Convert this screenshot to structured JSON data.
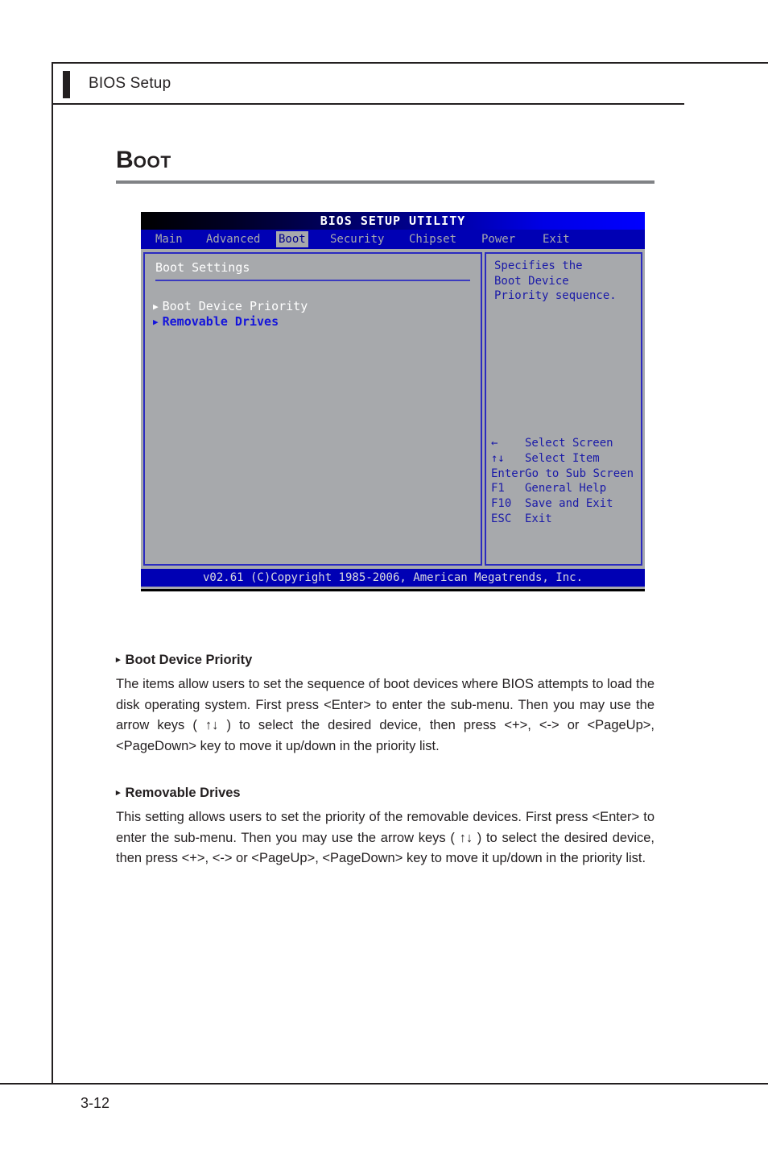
{
  "page": {
    "header_title": "BIOS Setup",
    "section_title_first": "B",
    "section_title_rest": "OOT",
    "page_number": "3-12"
  },
  "bios": {
    "window_title": "BIOS SETUP UTILITY",
    "menu": [
      {
        "label": "Main",
        "active": false
      },
      {
        "label": "Advanced",
        "active": false
      },
      {
        "label": "Boot",
        "active": true
      },
      {
        "label": "Security",
        "active": false
      },
      {
        "label": "Chipset",
        "active": false
      },
      {
        "label": "Power",
        "active": false
      },
      {
        "label": "Exit",
        "active": false
      }
    ],
    "left_panel": {
      "heading": "Boot Settings",
      "items": [
        {
          "label": "Boot Device Priority",
          "selected": false
        },
        {
          "label": "Removable Drives",
          "selected": true
        }
      ]
    },
    "right_panel": {
      "help_text": "Specifies the\nBoot Device\nPriority sequence.",
      "key_legend": [
        {
          "key": "←",
          "desc": "Select Screen"
        },
        {
          "key": "↑↓",
          "desc": "Select Item"
        },
        {
          "key": "Enter",
          "desc": "Go to Sub Screen"
        },
        {
          "key": "F1",
          "desc": "General Help"
        },
        {
          "key": "F10",
          "desc": "Save and Exit"
        },
        {
          "key": "ESC",
          "desc": "Exit"
        }
      ]
    },
    "status_bar": "v02.61 (C)Copyright 1985-2006, American Megatrends, Inc.",
    "colors": {
      "panel_bg": "#a7a9ac",
      "menu_bg": "#0000b4",
      "border": "#2b2bc0",
      "selected_text": "#1414dc",
      "help_text": "#1a1aa8"
    }
  },
  "sections": [
    {
      "heading": "Boot Device Priority",
      "body": "The items allow users to set the sequence of boot devices where BIOS attempts to load the disk operating system. First press <Enter> to enter the sub-menu. Then you may use the arrow keys ( ↑↓ ) to select the desired device, then press <+>, <-> or <PageUp>, <PageDown> key to move it up/down in the priority list."
    },
    {
      "heading": "Removable Drives",
      "body": "This setting allows users to set the priority of the removable devices. First press <Enter> to enter the sub-menu. Then you may use the arrow keys ( ↑↓ ) to select the desired device, then press <+>, <-> or <PageUp>, <PageDown> key to move it up/down in the priority list."
    }
  ]
}
